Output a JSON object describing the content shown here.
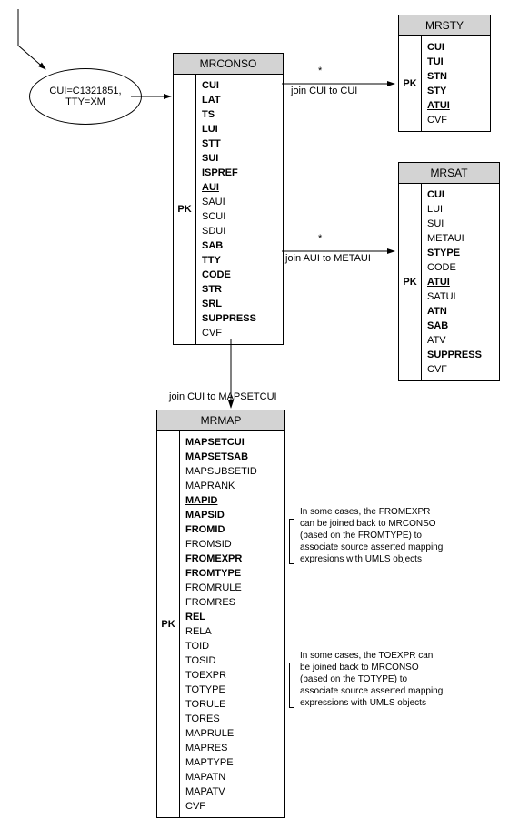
{
  "ellipse": {
    "text": "CUI=C1321851,\nTTY=XM"
  },
  "joins": {
    "j1": "join CUI to CUI",
    "j2": "join AUI to METAUI",
    "j3": "join CUI to MAPSETCUI",
    "star": "*"
  },
  "notes": {
    "n1": "In some cases, the FROMEXPR can be joined back to MRCONSO (based on the FROMTYPE) to associate source asserted mapping expresions with UMLS objects",
    "n2": "In some cases, the TOEXPR can be joined back to MRCONSO (based on the TOTYPE) to associate source asserted mapping expressions with UMLS objects"
  },
  "tables": {
    "mrconso": {
      "title": "MRCONSO",
      "pk": "PK",
      "cols": [
        {
          "t": "CUI",
          "b": true
        },
        {
          "t": "LAT",
          "b": true
        },
        {
          "t": "TS",
          "b": true
        },
        {
          "t": "LUI",
          "b": true
        },
        {
          "t": "STT",
          "b": true
        },
        {
          "t": "SUI",
          "b": true
        },
        {
          "t": "ISPREF",
          "b": true
        },
        {
          "t": "AUI",
          "b": true,
          "u": true
        },
        {
          "t": "SAUI"
        },
        {
          "t": "SCUI"
        },
        {
          "t": "SDUI"
        },
        {
          "t": "SAB",
          "b": true
        },
        {
          "t": "TTY",
          "b": true
        },
        {
          "t": "CODE",
          "b": true
        },
        {
          "t": "STR",
          "b": true
        },
        {
          "t": "SRL",
          "b": true
        },
        {
          "t": "SUPPRESS",
          "b": true
        },
        {
          "t": "CVF"
        }
      ]
    },
    "mrsty": {
      "title": "MRSTY",
      "pk": "PK",
      "cols": [
        {
          "t": "CUI",
          "b": true
        },
        {
          "t": "TUI",
          "b": true
        },
        {
          "t": "STN",
          "b": true
        },
        {
          "t": "STY",
          "b": true
        },
        {
          "t": "ATUI",
          "b": true,
          "u": true
        },
        {
          "t": "CVF"
        }
      ]
    },
    "mrsat": {
      "title": "MRSAT",
      "pk": "PK",
      "cols": [
        {
          "t": "CUI",
          "b": true
        },
        {
          "t": "LUI"
        },
        {
          "t": "SUI"
        },
        {
          "t": "METAUI"
        },
        {
          "t": "STYPE",
          "b": true
        },
        {
          "t": "CODE"
        },
        {
          "t": "ATUI",
          "b": true,
          "u": true
        },
        {
          "t": "SATUI"
        },
        {
          "t": "ATN",
          "b": true
        },
        {
          "t": "SAB",
          "b": true
        },
        {
          "t": "ATV"
        },
        {
          "t": "SUPPRESS",
          "b": true
        },
        {
          "t": "CVF"
        }
      ]
    },
    "mrmap": {
      "title": "MRMAP",
      "pk": "PK",
      "cols": [
        {
          "t": "MAPSETCUI",
          "b": true
        },
        {
          "t": "MAPSETSAB",
          "b": true
        },
        {
          "t": "MAPSUBSETID"
        },
        {
          "t": "MAPRANK"
        },
        {
          "t": "MAPID",
          "b": true,
          "u": true
        },
        {
          "t": "MAPSID",
          "b": true
        },
        {
          "t": "FROMID",
          "b": true
        },
        {
          "t": "FROMSID"
        },
        {
          "t": "FROMEXPR",
          "b": true
        },
        {
          "t": "FROMTYPE",
          "b": true
        },
        {
          "t": "FROMRULE"
        },
        {
          "t": "FROMRES"
        },
        {
          "t": "REL",
          "b": true
        },
        {
          "t": "RELA"
        },
        {
          "t": "TOID"
        },
        {
          "t": "TOSID"
        },
        {
          "t": "TOEXPR"
        },
        {
          "t": "TOTYPE"
        },
        {
          "t": "TORULE"
        },
        {
          "t": "TORES"
        },
        {
          "t": "MAPRULE"
        },
        {
          "t": "MAPRES"
        },
        {
          "t": "MAPTYPE"
        },
        {
          "t": "MAPATN"
        },
        {
          "t": "MAPATV"
        },
        {
          "t": "CVF"
        }
      ]
    }
  }
}
